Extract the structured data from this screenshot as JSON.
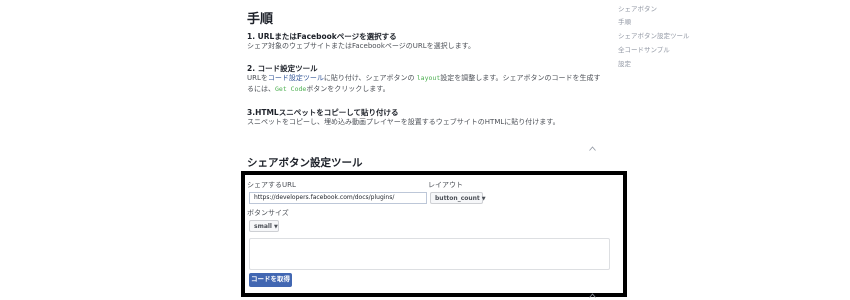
{
  "main": {
    "heading": "手順",
    "steps": [
      {
        "title": "1. URLまたはFacebookページを選択する",
        "desc": "シェア対象のウェブサイトまたはFacebookページのURLを選択します。"
      },
      {
        "title": "2. コード設定ツール",
        "desc_prefix": "URLを",
        "desc_link": "コード設定ツール",
        "desc_mid": "に貼り付け、シェアボタンの ",
        "desc_code1": "layout",
        "desc_mid2": "設定を調整します。シェアボタンのコードを生成するには、",
        "desc_code2": "Get Code",
        "desc_suffix": "ボタンをクリックします。"
      },
      {
        "title": "3.HTMLスニペットをコピーして貼り付ける",
        "desc": "スニペットをコピーし、埋め込み動画プレイヤーを設置するウェブサイトのHTMLに貼り付けます。"
      }
    ],
    "configurator_title": "シェアボタン設定ツール"
  },
  "sidebar": {
    "items": [
      "シェアボタン",
      "手順",
      "シェアボタン設定ツール",
      "全コードサンプル",
      "設定"
    ]
  },
  "form": {
    "url_label": "シェアするURL",
    "url_value": "https://developers.facebook.com/docs/plugins/",
    "layout_label": "レイアウト",
    "layout_value": "button_count",
    "size_label": "ボタンサイズ",
    "size_value": "small",
    "get_code_label": "コードを取得"
  },
  "icons": {
    "caret": "chevron-up-icon",
    "dropdown": "triangle-down-icon"
  }
}
